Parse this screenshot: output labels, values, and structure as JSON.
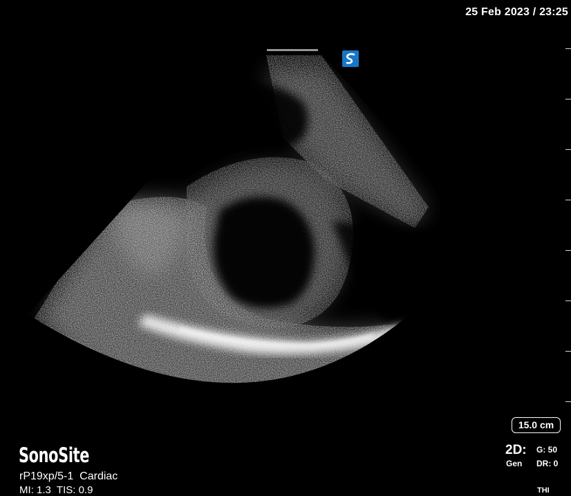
{
  "header": {
    "datetime": "25 Feb 2023 / 23:25"
  },
  "brand": {
    "logo_text": "SonoSite"
  },
  "transducer": {
    "probe_preset": "rP19xp/5-1  Cardiac",
    "output_indices": "MI: 1.3  TIS: 0.9"
  },
  "imaging": {
    "depth": "15.0 cm",
    "mode": "2D:",
    "mode_sub": "Gen",
    "gain": "G: 50",
    "dynamic_range": "DR: 0",
    "harmonic": "THI"
  },
  "icons": {
    "orientation_marker": "orientation-marker-icon",
    "marker_color": "#1677c8"
  },
  "colors": {
    "background": "#000000",
    "text": "#ffffff"
  }
}
